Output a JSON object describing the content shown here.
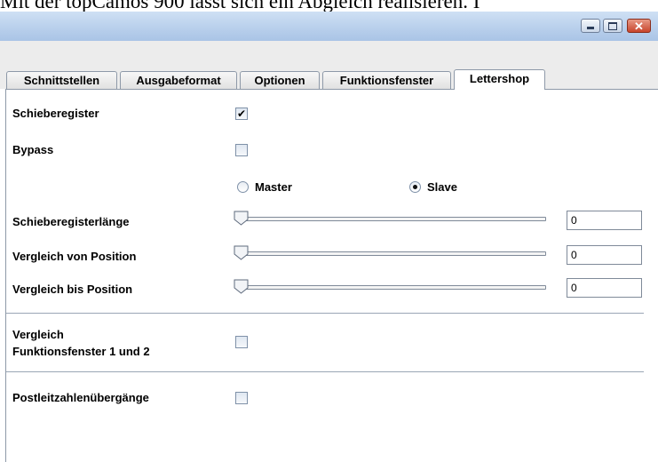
{
  "document": {
    "caption_fragment": "Mit der topCamos 900 lässt sich ein Abgleich realisieren. I"
  },
  "window": {
    "minimize_symbol": "",
    "maximize_symbol": "",
    "close_symbol": "✕"
  },
  "tabs": [
    {
      "label": "Schnittstellen"
    },
    {
      "label": "Ausgabeformat"
    },
    {
      "label": "Optionen"
    },
    {
      "label": "Funktionsfenster"
    },
    {
      "label": "Lettershop",
      "active": true
    }
  ],
  "form": {
    "schieberegister": {
      "label": "Schieberegister",
      "checked": true,
      "mark": "✔"
    },
    "bypass": {
      "label": "Bypass",
      "checked": false,
      "mark": ""
    },
    "mode": {
      "options": [
        "Master",
        "Slave"
      ],
      "selected": "Slave"
    },
    "sliders": [
      {
        "label": "Schieberegisterlänge",
        "value": "0"
      },
      {
        "label": "Vergleich von Position",
        "value": "0"
      },
      {
        "label": "Vergleich bis Position",
        "value": "0"
      }
    ],
    "vergleich": {
      "label_line1": "Vergleich",
      "label_line2": "Funktionsfenster 1 und 2",
      "checked": false
    },
    "postleitzahl": {
      "label": "Postleitzahlenübergänge",
      "checked": false
    }
  },
  "colors": {
    "titlebar": "#b9d0ec",
    "close_button": "#c8442b",
    "border": "#8e99a8"
  }
}
